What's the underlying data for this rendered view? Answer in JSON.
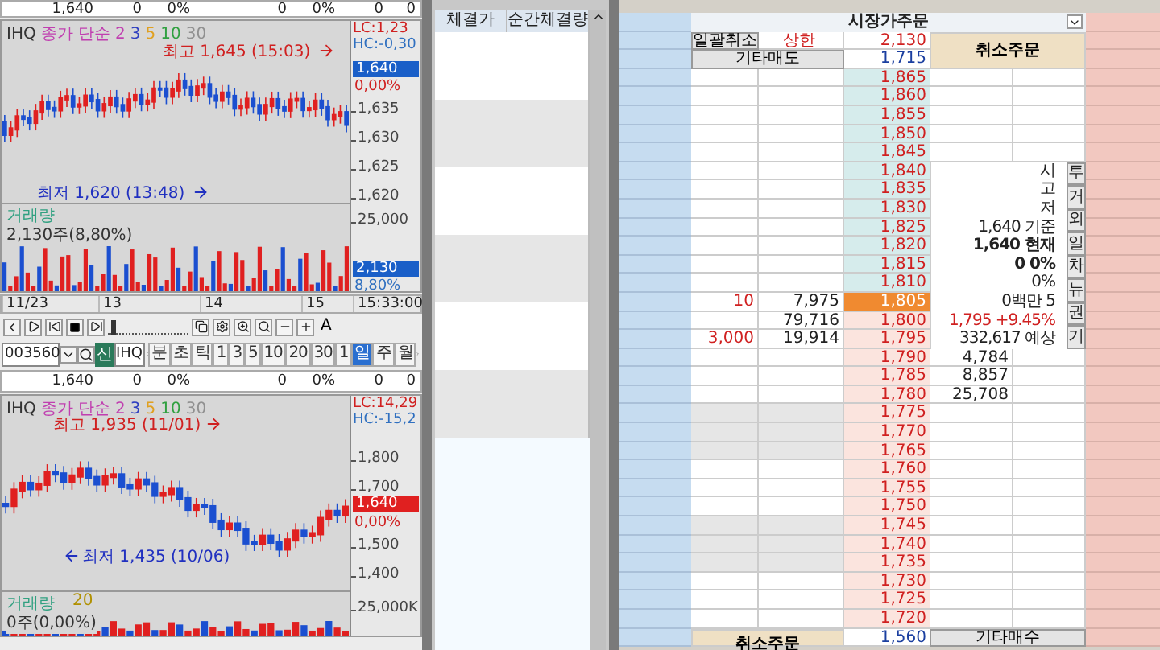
{
  "top_summary": [
    "1,640",
    "0",
    "0%",
    "0",
    "0%",
    "0",
    "0"
  ],
  "intraday_chart": {
    "symbol": "IHQ",
    "indicator": "종가 단순",
    "periods": [
      {
        "label": "2",
        "color": "#c03fb0"
      },
      {
        "label": "3",
        "color": "#3040c0"
      },
      {
        "label": "5",
        "color": "#e0a020"
      },
      {
        "label": "10",
        "color": "#30a040"
      },
      {
        "label": "30",
        "color": "#909090"
      }
    ],
    "lc": "LC:1,23",
    "hc": "HC:-0,30",
    "high_label": "최고 1,645 (15:03)",
    "low_label": "최저 1,620 (13:48)",
    "price_ticks": [
      "1,635",
      "1,630",
      "1,625",
      "1,620"
    ],
    "price_badge": "1,640",
    "change_badge": "0,00%",
    "volume_title": "거래량",
    "volume_summary": "2,130주(8,80%)",
    "volume_tick": "25,000",
    "volume_badge": "2,130",
    "volume_pct": "8,80%",
    "x_labels": [
      "11/23",
      "13",
      "14",
      "15"
    ],
    "time": "15:33:00"
  },
  "toolbar": {
    "font_button": "A",
    "slider": {
      "level": 0.05
    }
  },
  "controls": {
    "code": "003560",
    "new_badge": "신",
    "name": "IHQ",
    "periods": [
      {
        "label": "분",
        "selected": false
      },
      {
        "label": "초",
        "selected": false
      },
      {
        "label": "틱",
        "selected": false
      },
      {
        "label": "1",
        "selected": false
      },
      {
        "label": "3",
        "selected": false
      },
      {
        "label": "5",
        "selected": false
      },
      {
        "label": "10",
        "selected": false
      },
      {
        "label": "20",
        "selected": false
      },
      {
        "label": "30",
        "selected": false
      },
      {
        "label": "1",
        "selected": false
      },
      {
        "label": "일",
        "selected": true
      },
      {
        "label": "주",
        "selected": false
      },
      {
        "label": "월",
        "selected": false
      }
    ]
  },
  "summary": [
    "1,640",
    "0",
    "0%",
    "0",
    "0%",
    "0",
    "0"
  ],
  "daily_chart": {
    "symbol": "IHQ",
    "indicator": "종가 단순",
    "periods": [
      {
        "label": "2",
        "color": "#c03fb0"
      },
      {
        "label": "3",
        "color": "#3040c0"
      },
      {
        "label": "5",
        "color": "#e0a020"
      },
      {
        "label": "10",
        "color": "#30a040"
      },
      {
        "label": "30",
        "color": "#909090"
      }
    ],
    "lc": "LC:14,29",
    "hc": "HC:-15,2",
    "high_label": "최고 1,935 (11/01)",
    "low_label": "최저 1,435 (10/06)",
    "price_ticks": [
      "1,800",
      "1,700",
      "1,500",
      "1,400"
    ],
    "price_badge": "1,640",
    "change_badge": "0,00%",
    "volume_title": "거래량",
    "volume_ma": "20",
    "volume_summary": "0주(0,00%)",
    "volume_tick": "25,000K"
  },
  "trades_table": {
    "columns": [
      "체결가",
      "순간체결량"
    ]
  },
  "order_book": {
    "title": "시장가주문",
    "bulk_cancel": "일괄취소",
    "upper_label": "상한",
    "upper_price": "2,130",
    "cancel_top": "취소주문",
    "other_sell": "기타매도",
    "price_2": "1,715",
    "levels": [
      {
        "price": "1,865",
        "kind": "ask",
        "current": false
      },
      {
        "price": "1,860",
        "kind": "ask",
        "current": false
      },
      {
        "price": "1,855",
        "kind": "ask",
        "current": false
      },
      {
        "price": "1,850",
        "kind": "ask",
        "current": false
      },
      {
        "price": "1,845",
        "kind": "ask",
        "current": false
      },
      {
        "price": "1,840",
        "kind": "ask",
        "current": false
      },
      {
        "price": "1,835",
        "kind": "ask",
        "current": false
      },
      {
        "price": "1,830",
        "kind": "ask",
        "current": false
      },
      {
        "price": "1,825",
        "kind": "ask",
        "current": false
      },
      {
        "price": "1,820",
        "kind": "ask",
        "current": false
      },
      {
        "price": "1,815",
        "kind": "ask",
        "current": false
      },
      {
        "price": "1,810",
        "kind": "ask",
        "current": false
      },
      {
        "price": "1,805",
        "kind": "ask",
        "current": true,
        "left_1": "10",
        "left_2": "7,975"
      },
      {
        "price": "1,800",
        "kind": "bid",
        "current": false,
        "left_2": "79,716"
      },
      {
        "price": "1,795",
        "kind": "bid",
        "current": false,
        "left_1": "3,000",
        "left_2": "19,914"
      },
      {
        "price": "1,790",
        "kind": "bid",
        "current": false,
        "right_1": "4,784"
      },
      {
        "price": "1,785",
        "kind": "bid",
        "current": false,
        "right_1": "8,857"
      },
      {
        "price": "1,780",
        "kind": "bid",
        "current": false,
        "right_1": "25,708"
      },
      {
        "price": "1,775",
        "kind": "bid",
        "current": false
      },
      {
        "price": "1,770",
        "kind": "bid",
        "current": false
      },
      {
        "price": "1,765",
        "kind": "bid",
        "current": false
      },
      {
        "price": "1,760",
        "kind": "bid",
        "current": false
      },
      {
        "price": "1,755",
        "kind": "bid",
        "current": false
      },
      {
        "price": "1,750",
        "kind": "bid",
        "current": false
      },
      {
        "price": "1,745",
        "kind": "bid",
        "current": false
      },
      {
        "price": "1,740",
        "kind": "bid",
        "current": false
      },
      {
        "price": "1,735",
        "kind": "bid",
        "current": false
      },
      {
        "price": "1,730",
        "kind": "bid",
        "current": false
      },
      {
        "price": "1,725",
        "kind": "bid",
        "current": false
      },
      {
        "price": "1,720",
        "kind": "bid",
        "current": false
      }
    ],
    "info": [
      {
        "kind": "plain",
        "text": "시"
      },
      {
        "kind": "plain",
        "text": "고"
      },
      {
        "kind": "plain",
        "text": "저"
      },
      {
        "kind": "plain",
        "text": "1,640 기준"
      },
      {
        "kind": "bold",
        "text": "1,640 현재"
      },
      {
        "kind": "bold",
        "text": "0 0%"
      },
      {
        "kind": "plain",
        "text": "0%"
      },
      {
        "kind": "plain",
        "text": "0백만 5"
      },
      {
        "kind": "up",
        "text": "1,795 +9.45%"
      },
      {
        "kind": "plain",
        "text": "332,617 예상"
      }
    ],
    "side_buttons": [
      "투",
      "거",
      "외",
      "일",
      "차",
      "뉴",
      "권",
      "기"
    ],
    "cancel_bottom": "취소주문",
    "bottom_price": "1,560",
    "other_buy": "기타매수"
  }
}
